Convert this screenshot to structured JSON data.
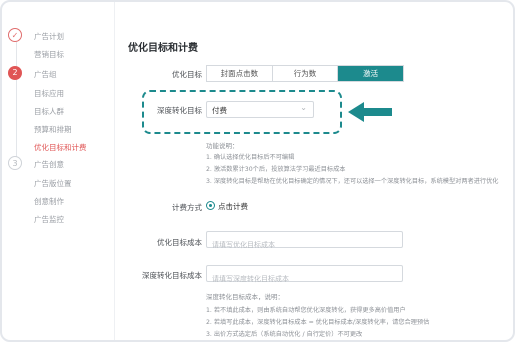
{
  "sidebar": {
    "step1": {
      "badge": "✓",
      "label": "广告计划"
    },
    "step1_items": [
      "营销目标"
    ],
    "step2": {
      "badge": "2",
      "label": "广告组"
    },
    "step2_items": [
      "目标应用",
      "目标人群",
      "预算和排期",
      "优化目标和计费"
    ],
    "step3": {
      "badge": "3",
      "label": "广告创意"
    },
    "step3_items": [
      "广告版位置",
      "创意制作",
      "广告监控"
    ]
  },
  "main": {
    "title": "优化目标和计费",
    "optimize": {
      "label": "优化目标",
      "options": [
        "封面点击数",
        "行为数",
        "激活"
      ],
      "selected": "激活"
    },
    "deep": {
      "label": "深度转化目标",
      "value": "付费"
    },
    "help": {
      "title": "功能说明：",
      "lines": [
        "1. 确认选择优化目标后不可编辑",
        "2. 激活数累计30个后，投放算法学习最近目标成本",
        "3. 深度转化目标是帮助在优化目标确定的情况下，还可以选择一个深度转化目标，系统模型对两者进行优化"
      ]
    },
    "billing": {
      "label": "计费方式",
      "option": "点击计费"
    },
    "cost": {
      "label": "优化目标成本",
      "placeholder": "请填写优化目标成本"
    },
    "deep_cost": {
      "label": "深度转化目标成本",
      "placeholder": "请填写深度转化目标成本"
    },
    "note": {
      "title": "深度转化目标成本，说明：",
      "lines": [
        "1. 若不填此成本，则由系统自动帮您优化深度转化，获得更多高价值用户",
        "2. 若填写此成本，深度转化目标成本 = 优化目标成本/深度转化率，请您合理预估",
        "3. 出价方式选定后（系统自动优化 / 自行定价）不可更改"
      ]
    }
  },
  "colors": {
    "accent": "#1c8a8d",
    "step_active": "#e05555"
  }
}
